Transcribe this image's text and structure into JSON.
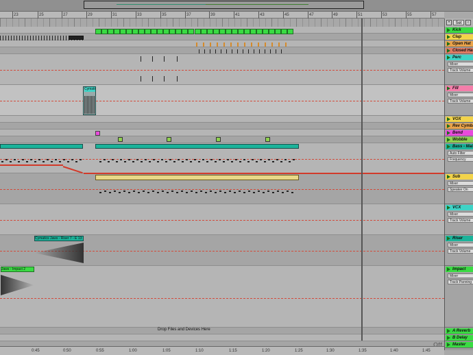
{
  "overview": {},
  "beat_ruler": [
    "23",
    "25",
    "27",
    "29",
    "31",
    "33",
    "35",
    "37",
    "39",
    "41",
    "43",
    "45",
    "47",
    "49",
    "51",
    "53",
    "55",
    "57"
  ],
  "time_ruler": [
    "0:45",
    "0:50",
    "0:55",
    "1:00",
    "1:05",
    "1:10",
    "1:15",
    "1:20",
    "1:25",
    "1:30",
    "1:35",
    "1:40",
    "1:45"
  ],
  "top_controls": {
    "set_label": "Set"
  },
  "tracks": [
    {
      "name": "Kick",
      "color": "#3adb43",
      "subs": []
    },
    {
      "name": "Clap",
      "color": "#f2d34a",
      "subs": []
    },
    {
      "name": "Open Hat",
      "color": "#e9a24a",
      "subs": []
    },
    {
      "name": "Closed Hat",
      "color": "#e07a63",
      "subs": []
    },
    {
      "name": "Perc",
      "color": "#3fd3c6",
      "subs": [
        "Mixer",
        "Track Volume"
      ]
    },
    {
      "name": "Fill",
      "color": "#f47eaa",
      "subs": [
        "Mixer",
        "Track Volume"
      ]
    },
    {
      "name": "VOX",
      "color": "#f2d34a",
      "subs": []
    },
    {
      "name": "Rev Cymbal",
      "color": "#e9a24a",
      "subs": []
    },
    {
      "name": "Bend",
      "color": "#e94bdc",
      "subs": []
    },
    {
      "name": "Wobble",
      "color": "#8fd14f",
      "subs": []
    },
    {
      "name": "Bass - Main",
      "color": "#1bb39a",
      "subs": [
        "Auto Filter",
        "Frequency"
      ]
    },
    {
      "name": "Sub",
      "color": "#f2d34a",
      "subs": [
        "Mixer",
        "Speaker On"
      ]
    },
    {
      "name": "VCX",
      "color": "#3fd3c6",
      "subs": [
        "Mixer",
        "Track Volume"
      ]
    },
    {
      "name": "Riser",
      "color": "#1bb39a",
      "subs": [
        "Mixer",
        "Track Volume"
      ]
    },
    {
      "name": "Impact",
      "color": "#3adb43",
      "subs": [
        "Mixer",
        "Track Panning"
      ]
    },
    {
      "name": "A Reverb",
      "color": "#3adb43",
      "subs": []
    },
    {
      "name": "B Delay",
      "color": "#3adb43",
      "subs": []
    },
    {
      "name": "Master",
      "color": "#3adb43",
      "subs": []
    }
  ],
  "clips": {
    "fill_clip": "Cymatic",
    "riser_clip": "Cymatics Jaws - Riser 7 - E 13",
    "impact_clip": "Jaws - Impact 2"
  },
  "drop_message": "Drop Files and Devices Here",
  "status": {
    "off_label": "Off"
  }
}
